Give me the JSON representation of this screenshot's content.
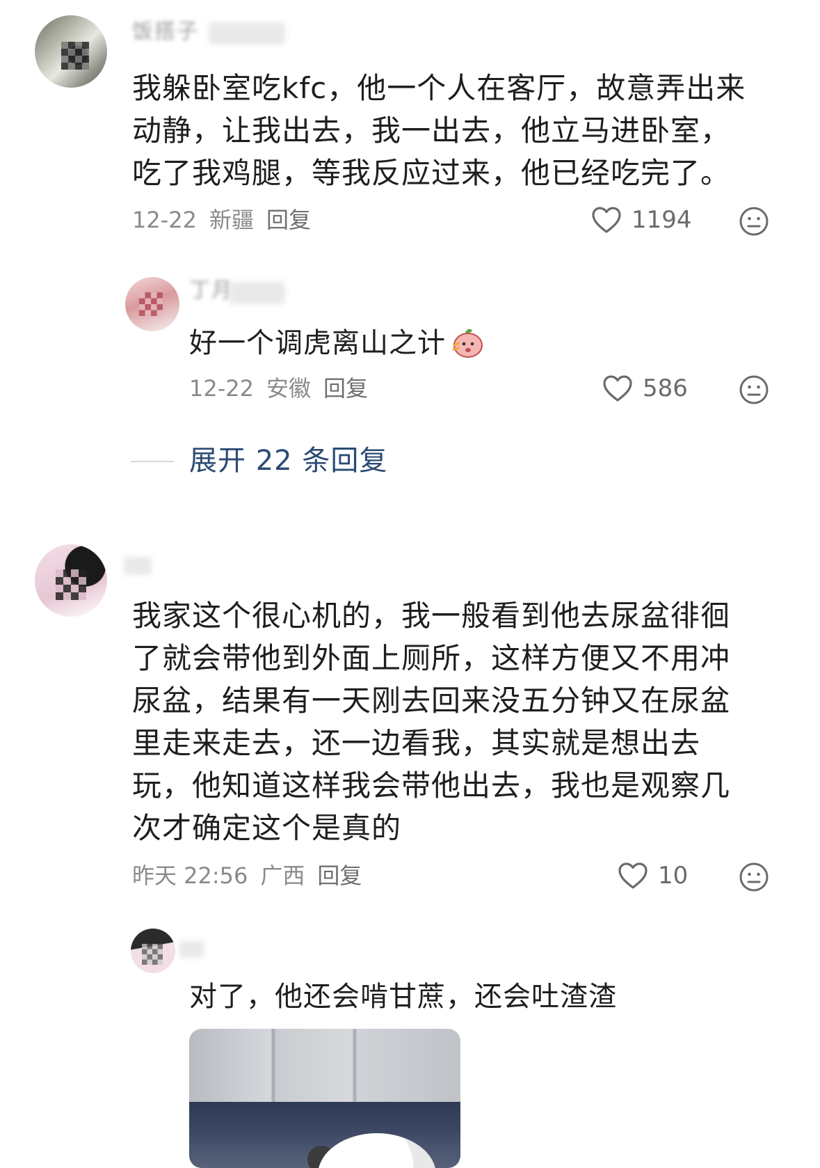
{
  "comments": [
    {
      "username": "饭搭子",
      "text": "我躲卧室吃kfc，他一个人在客厅，故意弄出来\n动静，让我出去，我一出去，他立马进卧室，\n吃了我鸡腿，等我反应过来，他已经吃完了。",
      "date": "12-22",
      "location": "新疆",
      "reply_label": "回复",
      "likes": "1194",
      "replies": [
        {
          "username": "丁月",
          "text": "好一个调虎离山之计",
          "sticker": "angry-peach-sticker",
          "date": "12-22",
          "location": "安徽",
          "reply_label": "回复",
          "likes": "586"
        }
      ],
      "expand_label": "展开 22 条回复"
    },
    {
      "username": "",
      "text": "我家这个很心机的，我一般看到他去尿盆徘徊\n了就会带他到外面上厕所，这样方便又不用冲\n尿盆，结果有一天刚去回来没五分钟又在尿盆\n里走来走去，还一边看我，其实就是想出去\n玩，他知道这样我会带他出去，我也是观察几\n次才确定这个是真的",
      "date": "昨天 22:56",
      "location": "广西",
      "reply_label": "回复",
      "likes": "10",
      "replies": [
        {
          "username": "",
          "text": "对了，他还会啃甘蔗，还会吐渣渣",
          "has_photo": true
        }
      ]
    }
  ],
  "icons": {
    "like": "heart-outline-icon",
    "emoji": "neutral-face-icon"
  },
  "colors": {
    "text": "#1e1e1e",
    "meta": "#8a8a8a",
    "link": "#2b4a74",
    "divider": "#d8d8d8"
  }
}
